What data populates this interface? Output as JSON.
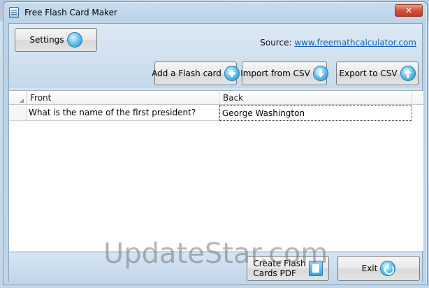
{
  "window": {
    "title": "Free Flash Card Maker",
    "close_glyph": "✕"
  },
  "toolbar": {
    "settings_label": "Settings",
    "source_prefix": "Source:",
    "source_link": "www.freemathcalculator.com",
    "add_label": "Add a Flash card",
    "import_label": "Import from CSV",
    "export_label": "Export to CSV"
  },
  "grid": {
    "columns": [
      "Front",
      "Back"
    ],
    "rows": [
      [
        "What is the name of the first president?",
        "George Washington"
      ]
    ]
  },
  "footer": {
    "create_pdf_line1": "Create Flash",
    "create_pdf_line2": "Cards PDF",
    "exit_label": "Exit"
  },
  "watermark": "UpdateStar.com",
  "icons": {
    "settings": "gear-icon",
    "add": "plus-circle-icon",
    "import": "arrow-down-circle-icon",
    "export": "arrow-up-circle-icon",
    "create_pdf": "pdf-icon",
    "exit": "power-icon"
  },
  "colors": {
    "accent": "#1a8ac4",
    "link": "#1a5fb4",
    "close": "#c23a20"
  }
}
